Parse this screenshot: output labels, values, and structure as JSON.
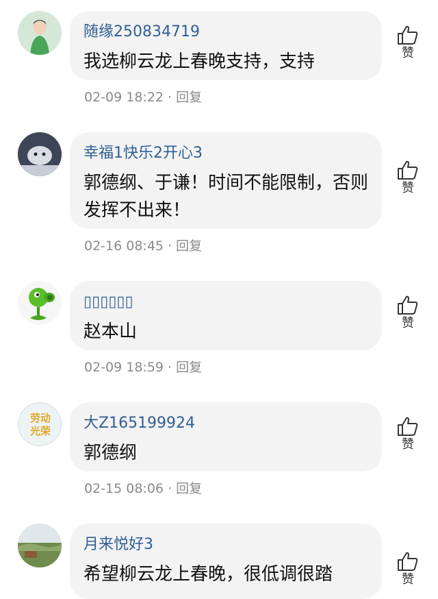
{
  "comments": [
    {
      "username": "随缘250834719",
      "content": "我选柳云龙上春晚支持，支持",
      "time": "02-09 18:22",
      "reply_label": "回复",
      "like_label": "赞",
      "avatar_icon": "girl-green-avatar-icon"
    },
    {
      "username": "幸福1快乐2开心3",
      "content": "郭德纲、于谦！时间不能限制，否则发挥不出来！",
      "time": "02-16 08:45",
      "reply_label": "回复",
      "like_label": "赞",
      "avatar_icon": "animal-photo-avatar-icon"
    },
    {
      "username": "▯▯▯▯▯▯",
      "content": "赵本山",
      "time": "02-09 18:59",
      "reply_label": "回复",
      "like_label": "赞",
      "avatar_icon": "peashooter-avatar-icon"
    },
    {
      "username": "大Z165199924",
      "content": "郭德纲",
      "time": "02-15 08:06",
      "reply_label": "回复",
      "like_label": "赞",
      "avatar_icon": "labor-glory-avatar-icon",
      "avatar_text": "劳动光荣"
    },
    {
      "username": "月来悦好3",
      "content": "希望柳云龙上春晚，很低调很踏",
      "like_label": "赞",
      "avatar_icon": "landscape-avatar-icon"
    }
  ]
}
